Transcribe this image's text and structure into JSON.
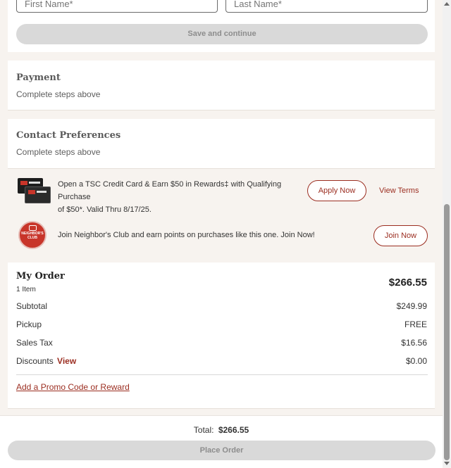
{
  "name_form": {
    "first_name_placeholder": "First Name*",
    "last_name_placeholder": "Last Name*",
    "save_button": "Save and continue"
  },
  "payment": {
    "title": "Payment",
    "subtitle": "Complete steps above"
  },
  "contact": {
    "title": "Contact Preferences",
    "subtitle": "Complete steps above"
  },
  "credit_promo": {
    "line1": "Open a TSC Credit Card & Earn $50 in Rewards‡ with Qualifying Purchase",
    "line2": "of $50*. Valid Thru 8/17/25.",
    "apply_button": "Apply Now",
    "terms_link": "View Terms"
  },
  "neighbors_club": {
    "badge_top": "NEIGHBOR'S",
    "badge_bottom": "CLUB",
    "text": "Join Neighbor's Club and earn points on purchases like this one. Join Now!",
    "join_button": "Join Now"
  },
  "order": {
    "title": "My Order",
    "items": "1 Item",
    "total": "$266.55",
    "rows": [
      {
        "label": "Subtotal",
        "value": "$249.99"
      },
      {
        "label": "Pickup",
        "value": "FREE"
      },
      {
        "label": "Sales Tax",
        "value": "$16.56"
      },
      {
        "label": "Discounts",
        "link": "View",
        "value": "$0.00"
      }
    ],
    "promo_link": "Add a Promo Code or Reward"
  },
  "footer": {
    "total_label": "Total:",
    "total_value": "$266.55",
    "place_order": "Place Order"
  },
  "colors": {
    "accent": "#9b2d20",
    "disabled": "#d9d9d9",
    "background": "#f7f3ef"
  }
}
